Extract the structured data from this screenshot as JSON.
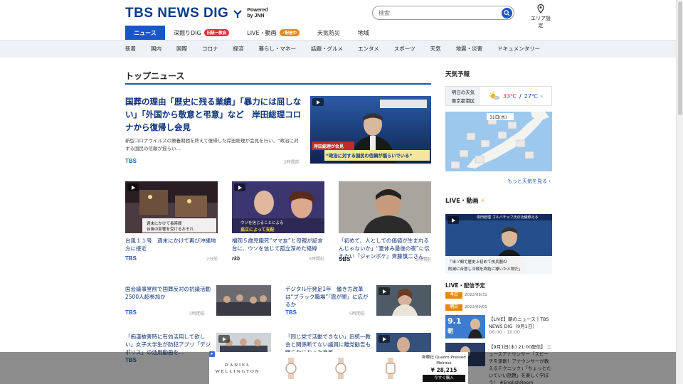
{
  "header": {
    "logo_text": "TBS NEWS DIG",
    "logo_powered": "Powered",
    "logo_by": "by JNN",
    "search_placeholder": "検索",
    "area_label": "エリア設定"
  },
  "main_nav": [
    {
      "label": "ニュース",
      "active": true
    },
    {
      "label": "深掘りDIG",
      "badge": "旧統一教会"
    },
    {
      "label": "LIVE・動画",
      "badge": "配信中"
    },
    {
      "label": "天気防災"
    },
    {
      "label": "地域"
    }
  ],
  "sub_nav": [
    "新着",
    "国内",
    "国際",
    "コロナ",
    "経済",
    "暮らし・マネー",
    "話題・グルメ",
    "エンタメ",
    "スポーツ",
    "天気",
    "地震・災害",
    "ドキュメンタリー"
  ],
  "top_news": {
    "heading": "トップニュース",
    "lead": {
      "title": "国葬の理由「歴史に残る業績」「暴力には屈しない」「外国から敬意と弔意」など　岸田総理コロナから復帰し会見",
      "desc": "新型コロナウイルスの療養期間を終えて復帰した岸田総理が会見を行い、“政治に対する国民の信頼が揺らい…",
      "source": "TBS",
      "time": "2時間前",
      "image_caption": "“政治に対する国民の信頼が揺らいでいる”",
      "image_name_tag": "岸田総理が会見"
    },
    "cards": [
      {
        "title": "台風１１号　週末にかけて再び沖縄地方に接近",
        "source": "TBS",
        "time": "2分前",
        "caption1": "週末にかけて長時間",
        "caption2": "台風の影響を受けるおそれ"
      },
      {
        "title": "福岡５歳児餓死“ママ友”と母親が証言台に、ウソを信じて孤立深めた経緯",
        "source": "rkb",
        "time": "5時間前",
        "caption1": "ウソを信じることによる",
        "caption2": "孤立によって支配"
      },
      {
        "title": "「初めて、人としての価値が生まれるんじゃないか」“夏休み最後の夜”に伝えたい『ジャンポケ』斉藤慎二さん…",
        "source": "SBS",
        "time": "5時間前"
      }
    ],
    "rows": [
      {
        "title": "国会議事堂前で国葬反対の抗議活動　2500人超参加か",
        "source": "TBS",
        "time": "3時間前"
      },
      {
        "title": "デジタル庁発足1年　働き方改革は“ブラック職場”「霞が関」に広がるか",
        "source": "TBS",
        "time": "5時間前"
      },
      {
        "title": "「痴漢被害時に有効活用して欲しい」女子大学生が防犯アプリ「デジポリス」の活用動画を…",
        "source": "TBS",
        "time": ""
      },
      {
        "title": "「同じ党で活動できない」旧統一教会と関係断てない議員に離党勧告も　明らかになった自民…",
        "source": "",
        "time": ""
      }
    ]
  },
  "sidebar": {
    "weather_heading": "天気予報",
    "weather_loc1": "明日の天気",
    "weather_loc2": "東京都港区",
    "weather_high": "33℃",
    "weather_sep": "/",
    "weather_low": "27℃",
    "map_date": "31日(水)",
    "more_weather": "もっと天気を見る",
    "live_heading": "LIVE・動画",
    "live_caption1": "「米ソ間で歴史上初めて核兵器の",
    "live_caption2": "削減に合意し冷戦を終結に導いた人物だ」",
    "live_banner": "岸田総理 ゴルバチョフ氏の功績称える",
    "schedule_heading": "LIVE・配信予定",
    "schedule": [
      {
        "tag": "今日",
        "date": "2022/08/31"
      },
      {
        "tag": "明日",
        "date": "2022/09/01"
      }
    ],
    "schedule_items": [
      {
        "title": "【LIVE】朝のニュース | TBS NEWS DIG（9月1日）",
        "time": "06:00 - 10:00",
        "thumb_text": "9.1",
        "thumb_sub": "朝"
      },
      {
        "title": "【9月1日(木) 21:00配信】 ニュースアナウンサー「スピーチを添削！アナウンサーが教えるテクニック」「ちょっとたいていい話題」を楽しく学ぼう！ #EnglishRoom",
        "time": "",
        "thumb_text": "",
        "thumb_sub": ""
      }
    ]
  },
  "ad": {
    "brand_line1": "DANIEL",
    "brand_line2": "WELLINGTON",
    "product_line1": "新韓社 Quadro Pressed",
    "product_line2": "Melrose",
    "price": "¥ 28,215",
    "buy_label": "今すぐ購入"
  },
  "colors": {
    "brand_blue": "#1a56c9",
    "title_navy": "#0a2f7a",
    "live_orange": "#e8870e",
    "badge_red": "#e0313d"
  }
}
